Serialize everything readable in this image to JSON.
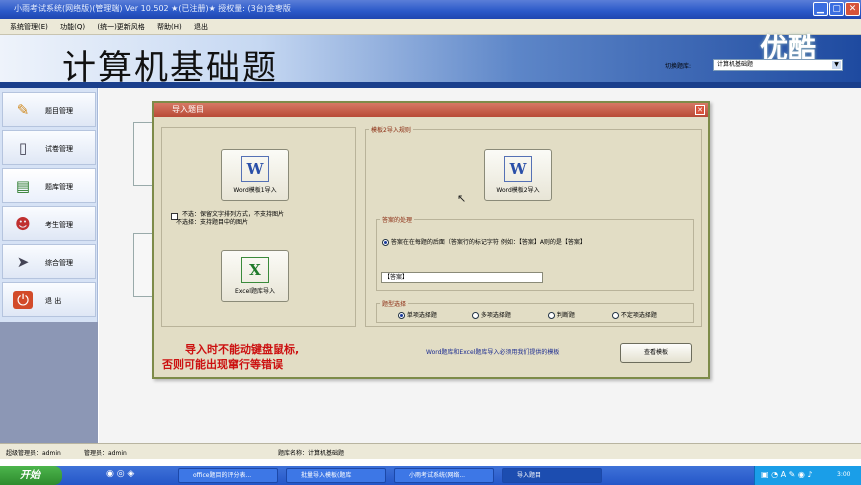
{
  "window": {
    "title": "小雨考试系统(网络版)(管理端) Ver 10.502 ★(已注册)★    授权量: (3台)金枣版"
  },
  "menu": [
    "系统管理(E)",
    "功能(Q)",
    "(统一)更新风格",
    "帮助(H)",
    "退出"
  ],
  "banner": {
    "title": "计算机基础题",
    "logo": "优酷",
    "bank_label": "切换题库:",
    "bank_value": "计算机基础题"
  },
  "sidebar": [
    {
      "label": "题目管理",
      "icon": "edit-doc-icon"
    },
    {
      "label": "试卷管理",
      "icon": "paper-icon"
    },
    {
      "label": "题库管理",
      "icon": "database-icon"
    },
    {
      "label": "考生管理",
      "icon": "users-icon"
    },
    {
      "label": "综合管理",
      "icon": "tools-icon"
    },
    {
      "label": "退 出",
      "icon": "power-icon"
    }
  ],
  "dialog": {
    "title": "导入题目",
    "word1_icon": "W",
    "word1_label": "Word模板1导入",
    "option_text_1": "不选：保留文字排列方式，不支持图片",
    "option_text_2": "不选择：支持题目中的图片",
    "excel_icon": "X",
    "excel_label": "Excel题库导入",
    "template2_group": "模板2导入规则",
    "word2_icon": "W",
    "word2_label": "Word模板2导入",
    "answer_group": "答案的处理",
    "answer_option": "答案在在每题的后面（答案行的标记字符 例如：【答案】A则的是【答案】",
    "answer_marker": "【答案】",
    "type_group": "题型选择",
    "types": [
      "单项选择题",
      "多项选择题",
      "判断题",
      "不定项选择题"
    ],
    "selected_type": "单项选择题",
    "note": "Word题库和Excel题库导入必须用我们提供的模板",
    "view_template": "查看模板",
    "warning_1": "导入时不能动键盘鼠标,",
    "warning_2": "否则可能出现窜行等错误"
  },
  "status": {
    "super_admin": "超级管理员：admin",
    "admin": "管理员：admin",
    "bank_name": "题库名称：计算机基础题"
  },
  "taskbar": {
    "start": "开始",
    "tasks": [
      "office题目的评分表...",
      "批量导入模板(题库",
      "小雨考试系统(网络...",
      "导入题目"
    ],
    "clock": "3:00"
  }
}
